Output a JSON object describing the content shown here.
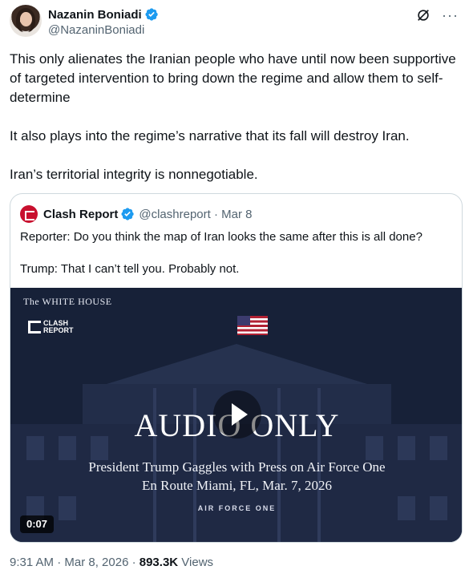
{
  "author": {
    "name": "Nazanin Boniadi",
    "handle": "@NazaninBoniadi",
    "verified_icon": "verified-badge-icon",
    "verified_color": "#1d9bf0"
  },
  "header_actions": {
    "grok_icon": "grok-icon",
    "more_label": "···"
  },
  "post": {
    "paragraph1": "This only alienates the Iranian people who have until now been supportive of targeted intervention to bring down the regime and allow them to self-determine",
    "paragraph2": "It also plays into the regime’s narrative that its fall will destroy Iran.",
    "paragraph3": "Iran’s territorial integrity is nonnegotiable."
  },
  "quoted_post": {
    "name": "Clash Report",
    "handle_date": "@clashreport · Mar 8",
    "line1": "Reporter: Do you think the map of Iran looks the same after this is all done?",
    "line2": "Trump: That I can’t tell you. Probably not.",
    "media": {
      "white_house_label": "The WHITE HOUSE",
      "logo_line1": "CLASH",
      "logo_line2": "REPORT",
      "title": "AUDIO ONLY",
      "subtitle1": "President Trump Gaggles with Press on Air Force One",
      "subtitle2": "En Route Miami, FL, Mar. 7, 2026",
      "subtitle3": "AIR FORCE ONE",
      "duration": "0:07",
      "background_color": "#1e2a44"
    }
  },
  "footer": {
    "timestamp": "9:31 AM · Mar 8, 2026 · ",
    "views_count": "893.3K",
    "views_label": " Views"
  }
}
